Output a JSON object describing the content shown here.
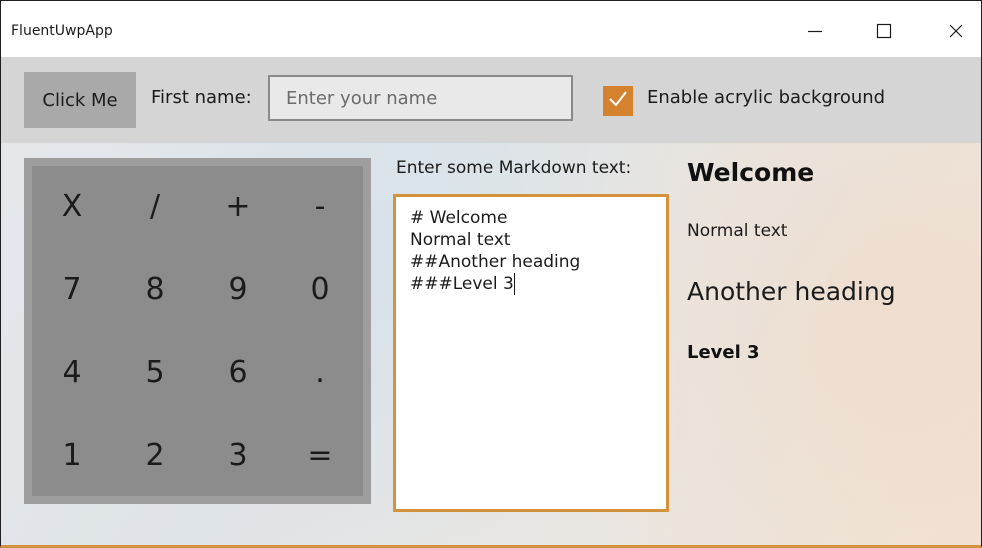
{
  "window": {
    "title": "FluentUwpApp",
    "minimize_icon": "minimize-icon",
    "maximize_icon": "maximize-icon",
    "close_icon": "close-icon"
  },
  "toolbar": {
    "click_button_label": "Click Me",
    "first_name_label": "First name:",
    "name_placeholder": "Enter your name",
    "name_value": "",
    "acrylic_checked": true,
    "acrylic_label": "Enable acrylic background"
  },
  "calculator": {
    "keys": [
      [
        "X",
        "/",
        "+",
        "-"
      ],
      [
        "7",
        "8",
        "9",
        "0"
      ],
      [
        "4",
        "5",
        "6",
        "."
      ],
      [
        "1",
        "2",
        "3",
        "="
      ]
    ]
  },
  "markdown": {
    "label": "Enter some Markdown text:",
    "lines": [
      "# Welcome",
      "Normal text",
      "##Another heading",
      "###Level 3"
    ]
  },
  "preview": {
    "h1": "Welcome",
    "p": "Normal text",
    "h2": "Another heading",
    "h3": "Level 3"
  },
  "colors": {
    "accent": "#d4822e",
    "toolbar_bg": "#d5d5d5",
    "calculator_bg": "#8c8c8c"
  }
}
